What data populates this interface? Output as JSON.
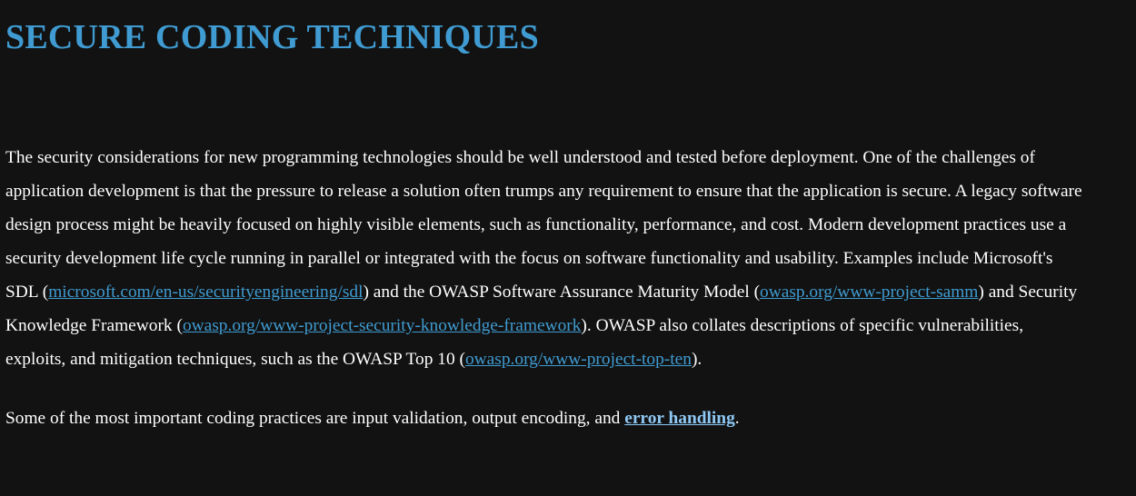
{
  "title": "SECURE CODING TECHNIQUES",
  "paragraph1": {
    "t1": "The security considerations for new programming technologies should be well understood and tested before deployment. One of the challenges of application development is that the pressure to release a solution often trumps any requirement to ensure that the application is secure. A legacy software design process might be heavily focused on highly visible elements, such as functionality, performance, and cost. Modern development practices use a security development life cycle running in parallel or integrated with the focus on software functionality and usability. Examples include Microsoft's SDL (",
    "link1": "microsoft.com/en-us/securityengineering/sdl",
    "t2": ") and the OWASP Software Assurance Maturity Model (",
    "link2": "owasp.org/www-project-samm",
    "t3": ") and Security Knowledge Framework (",
    "link3": "owasp.org/www-project-security-knowledge-framework",
    "t4": "). OWASP also collates descriptions of specific vulnerabilities, exploits, and mitigation techniques, such as the OWASP Top 10 (",
    "link4": "owasp.org/www-project-top-ten",
    "t5": ")."
  },
  "paragraph2": {
    "t1": "Some of the most important coding practices are input validation, output encoding, and ",
    "link1": "error handling",
    "t2": "."
  },
  "colors": {
    "background": "#121212",
    "heading": "#3f9bd1",
    "link": "#3f9bd1",
    "strong_link": "#8ec9f5",
    "text": "#ffffff"
  }
}
